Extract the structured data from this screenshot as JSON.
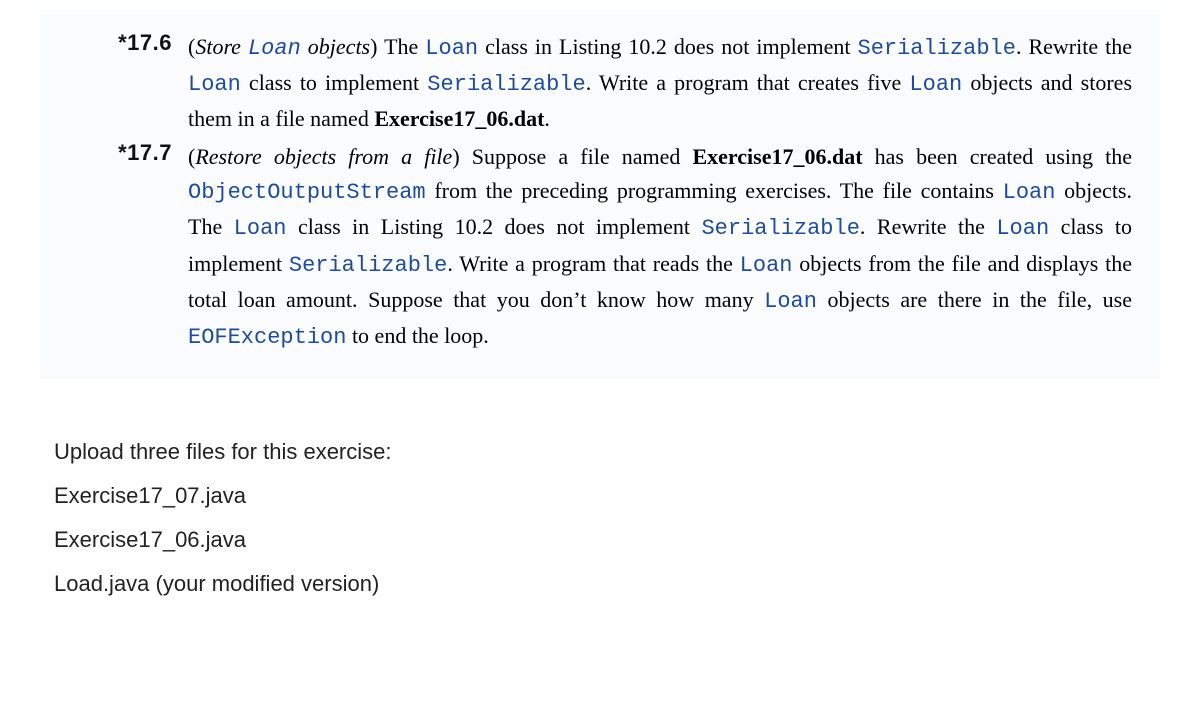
{
  "exercises": [
    {
      "num": "*17.6",
      "parts": [
        {
          "t": "(",
          "c": ""
        },
        {
          "t": "Store ",
          "c": "ital"
        },
        {
          "t": "Loan",
          "c": "ital code"
        },
        {
          "t": " objects",
          "c": "ital"
        },
        {
          "t": ") The ",
          "c": ""
        },
        {
          "t": "Loan",
          "c": "code"
        },
        {
          "t": " class in Listing 10.2 does not implement ",
          "c": ""
        },
        {
          "t": "Serializable",
          "c": "code"
        },
        {
          "t": ". Rewrite the ",
          "c": ""
        },
        {
          "t": "Loan",
          "c": "code"
        },
        {
          "t": " class to implement ",
          "c": ""
        },
        {
          "t": "Serializable",
          "c": "code"
        },
        {
          "t": ". Write a program that creates five ",
          "c": ""
        },
        {
          "t": "Loan",
          "c": "code"
        },
        {
          "t": " objects and stores them in a file named ",
          "c": ""
        },
        {
          "t": "Exercise17_06.dat",
          "c": "bold"
        },
        {
          "t": ".",
          "c": ""
        }
      ]
    },
    {
      "num": "*17.7",
      "parts": [
        {
          "t": "(",
          "c": ""
        },
        {
          "t": "Restore objects from a file",
          "c": "ital"
        },
        {
          "t": ") Suppose a file named ",
          "c": ""
        },
        {
          "t": "Exercise17_06.dat",
          "c": "bold"
        },
        {
          "t": " has been created using the ",
          "c": ""
        },
        {
          "t": "ObjectOutputStream",
          "c": "code"
        },
        {
          "t": " from the preceding program­ming exercises. The file contains ",
          "c": ""
        },
        {
          "t": "Loan",
          "c": "code"
        },
        {
          "t": " objects. The ",
          "c": ""
        },
        {
          "t": "Loan",
          "c": "code"
        },
        {
          "t": " class in Listing 10.2 does not implement ",
          "c": ""
        },
        {
          "t": "Serializable",
          "c": "code"
        },
        {
          "t": ". Rewrite the ",
          "c": ""
        },
        {
          "t": "Loan",
          "c": "code"
        },
        {
          "t": " class to implement ",
          "c": ""
        },
        {
          "t": "Serializable",
          "c": "code"
        },
        {
          "t": ". Write a program that reads the ",
          "c": ""
        },
        {
          "t": "Loan",
          "c": "code"
        },
        {
          "t": " objects from the file and displays the total loan amount. Suppose that you don’t know how many ",
          "c": ""
        },
        {
          "t": "Loan",
          "c": "code"
        },
        {
          "t": " objects are there in the file, use ",
          "c": ""
        },
        {
          "t": "EOFException",
          "c": "code"
        },
        {
          "t": " to end the loop.",
          "c": ""
        }
      ]
    }
  ],
  "instructions": {
    "heading": "Upload three files for this exercise:",
    "files": [
      "Exercise17_07.java",
      "Exercise17_06.java",
      "Load.java   (your modified version)"
    ]
  }
}
